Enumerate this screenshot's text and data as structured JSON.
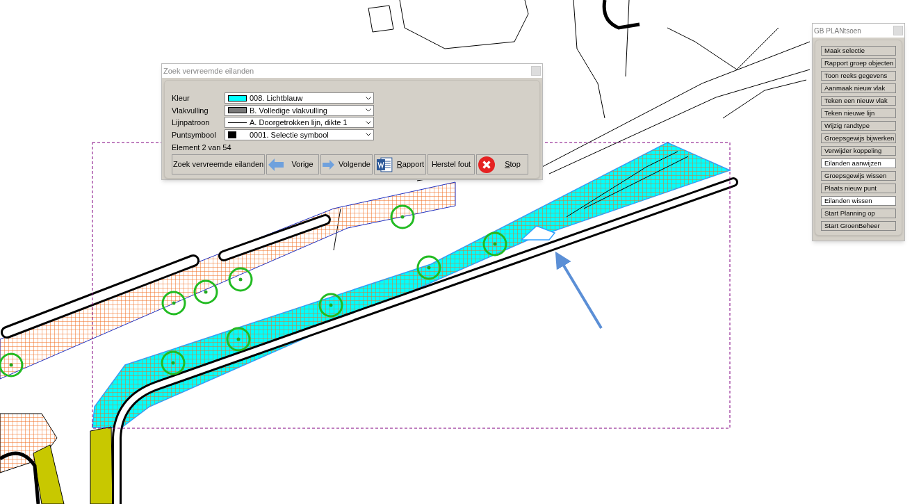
{
  "dialog": {
    "title": "Zoek vervreemde eilanden",
    "fields": [
      {
        "label": "Kleur",
        "kind": "color",
        "color": "#00ffff",
        "value": "008. Lichtblauw"
      },
      {
        "label": "Vlakvulling",
        "kind": "fill",
        "value": "B. Volledige vlakvulling"
      },
      {
        "label": "Lijnpatroon",
        "kind": "line",
        "value": "A. Doorgetrokken lijn, dikte 1"
      },
      {
        "label": "Puntsymbool",
        "kind": "point",
        "value": "0001. Selectie symbool"
      }
    ],
    "status": "Element 2 van 54",
    "buttons": [
      {
        "label": "Zoek vervreemde eilanden",
        "kind": "plain",
        "mnemonic": false
      },
      {
        "label": "Vorige",
        "kind": "back",
        "mnemonic": false
      },
      {
        "label": "Volgende",
        "kind": "next",
        "mnemonic": false
      },
      {
        "label": "Rapport",
        "kind": "report",
        "mnemonic": true
      },
      {
        "label": "Herstel fout",
        "kind": "plain",
        "mnemonic": false
      },
      {
        "label": "Stop",
        "kind": "stop",
        "mnemonic": true
      }
    ]
  },
  "panel": {
    "title": "GB PLANtsoen",
    "buttons": [
      {
        "label": "Maak selectie",
        "selected": false
      },
      {
        "label": "Rapport groep objecten",
        "selected": false
      },
      {
        "label": "Toon reeks gegevens",
        "selected": false
      },
      {
        "label": "Aanmaak nieuw vlak",
        "selected": false
      },
      {
        "label": "Teken een nieuw vlak",
        "selected": false
      },
      {
        "label": "Teken nieuwe lijn",
        "selected": false
      },
      {
        "label": "Wijzig randtype",
        "selected": false
      },
      {
        "label": "Groepsgewijs bijwerken",
        "selected": false
      },
      {
        "label": "Verwijder koppeling",
        "selected": false
      },
      {
        "label": "Eilanden aanwijzen",
        "selected": true
      },
      {
        "label": "Groepsgewijs wissen",
        "selected": false
      },
      {
        "label": "Plaats nieuw punt",
        "selected": false
      },
      {
        "label": "Eilanden wissen",
        "selected": true
      },
      {
        "label": "Start Planning op",
        "selected": false
      },
      {
        "label": "Start GroenBeheer",
        "selected": false
      }
    ]
  }
}
